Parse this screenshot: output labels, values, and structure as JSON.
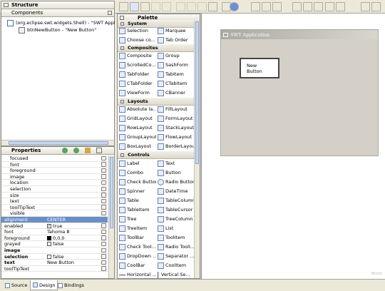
{
  "toolbar": {
    "icons": [
      "refresh-icon",
      "form-icon",
      "preview-icon",
      "undo-icon",
      "redo-icon",
      "cut-icon",
      "copy-icon",
      "paste-icon",
      "delete-icon",
      "test-icon",
      "globe-icon",
      "align-left-icon",
      "align-center-icon",
      "align-right-icon",
      "align-top-icon",
      "align-middle-icon",
      "align-bottom-icon",
      "grid-icon",
      "snap-icon"
    ]
  },
  "structure": {
    "title": "Structure",
    "components_label": "Components",
    "tree": [
      "(org.eclipse.swt.widgets.Shell) - \"SWT Applic",
      "btnNewButton - \"New Button\""
    ]
  },
  "properties": {
    "title": "Properties",
    "rows": [
      {
        "key": "focused",
        "value": ""
      },
      {
        "key": "font",
        "value": ""
      },
      {
        "key": "foreground",
        "value": ""
      },
      {
        "key": "image",
        "value": ""
      },
      {
        "key": "location",
        "value": ""
      },
      {
        "key": "selection",
        "value": ""
      },
      {
        "key": "size",
        "value": ""
      },
      {
        "key": "text",
        "value": ""
      },
      {
        "key": "toolTipText",
        "value": ""
      },
      {
        "key": "visible",
        "value": ""
      },
      {
        "key": "alignment",
        "value": "CENTER"
      },
      {
        "key": "enabled",
        "value": "true"
      },
      {
        "key": "font",
        "value": "Tahoma 8"
      },
      {
        "key": "foreground",
        "value": "0,0,0"
      },
      {
        "key": "grayed",
        "value": "false"
      },
      {
        "key": "image",
        "value": ""
      },
      {
        "key": "selection",
        "value": "false"
      },
      {
        "key": "text",
        "value": "New Button"
      },
      {
        "key": "toolTipText",
        "value": ""
      }
    ]
  },
  "palette": {
    "title": "Palette",
    "categories": [
      {
        "name": "System",
        "items": [
          "Selection",
          "Marquee",
          "Choose co...",
          "Tab Order"
        ]
      },
      {
        "name": "Composites",
        "items": [
          "Composite",
          "Group",
          "ScrolledCo...",
          "SashForm",
          "TabFolder",
          "TabItem",
          "CTabFolder",
          "CTabItem",
          "ViewForm",
          "CBanner"
        ]
      },
      {
        "name": "Layouts",
        "items": [
          "Absolute la...",
          "FillLayout",
          "GridLayout",
          "FormLayout",
          "RowLayout",
          "StackLayout",
          "GroupLayout",
          "FlowLayout",
          "BoxLayout",
          "BorderLayout"
        ]
      },
      {
        "name": "Controls",
        "items": [
          "Label",
          "Text",
          "Combo",
          "Button",
          "Check Button",
          "Radio Button",
          "Spinner",
          "DateTime",
          "Table",
          "TableColumn",
          "TableItem",
          "TableCursor",
          "Tree",
          "TreeColumn",
          "TreeItem",
          "List",
          "ToolBar",
          "ToolItem",
          "Check Tool...",
          "Radio ToolI...",
          "DropDown ...",
          "Separator ...",
          "CoolBar",
          "CoolItem",
          "Horizontal ...",
          "Vertical Se..."
        ]
      }
    ]
  },
  "design": {
    "window_title": "SWT Application",
    "button_label": "New Button",
    "watermark": "Windo"
  },
  "tabs": [
    {
      "label": "Source",
      "icon": "source-icon"
    },
    {
      "label": "Design",
      "icon": "design-icon"
    },
    {
      "label": "Bindings",
      "icon": "bindings-icon"
    }
  ]
}
